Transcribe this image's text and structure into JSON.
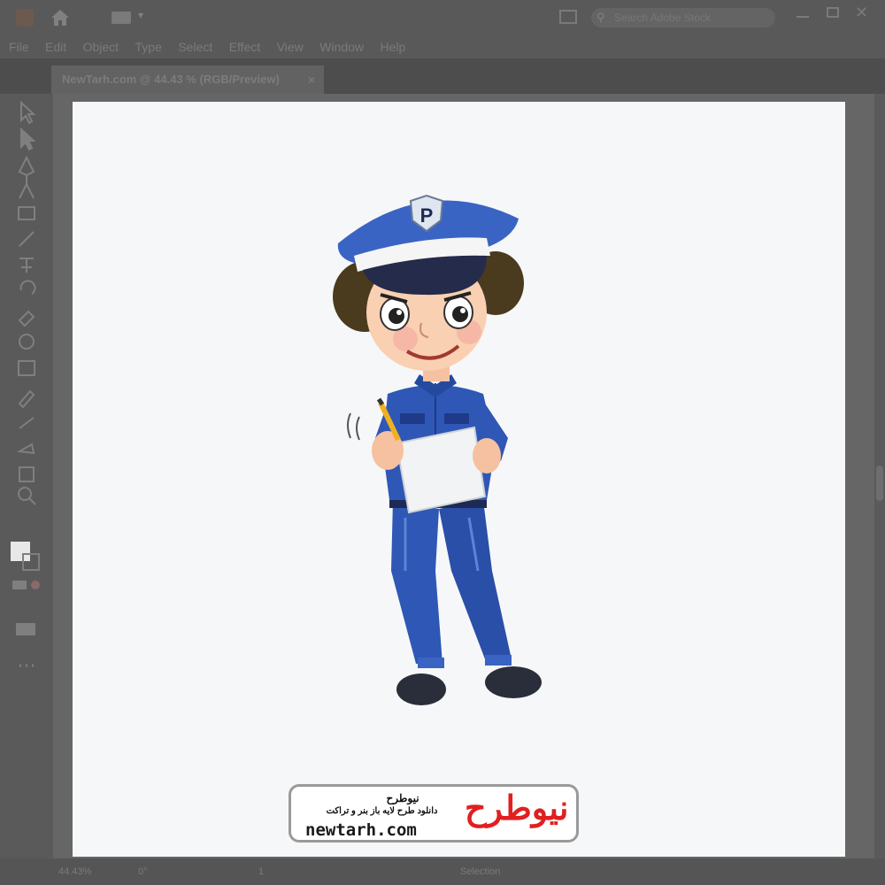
{
  "app": {
    "menu": [
      "File",
      "Edit",
      "Object",
      "Type",
      "Select",
      "Effect",
      "View",
      "Window",
      "Help"
    ],
    "search_placeholder": "Search Adobe Stock"
  },
  "document": {
    "tab_title": "NewTarh.com @ 44.43 % (RGB/Preview)",
    "close_symbol": "×"
  },
  "status": {
    "zoom": "44.43%",
    "rotation": "0°",
    "artboard_number": "1",
    "tool_name": "Selection"
  },
  "watermark": {
    "title_fa": "نیوطرح",
    "subtitle_fa": "دانلود طرح لایه باز بنر و تراکت",
    "mark_fa": "نیوطرح",
    "url": "newtarh.com"
  },
  "illustration": {
    "badge_letter": "P"
  },
  "colors": {
    "chrome": "#595959",
    "artboard": "#f6f7f8",
    "uniform_blue": "#2f57b5",
    "brand_red": "#e02020"
  },
  "icons": [
    "illustrator-logo-icon",
    "home-icon",
    "workspace-switcher-icon",
    "arrange-documents-icon",
    "search-icon",
    "minimize-icon",
    "maximize-icon",
    "close-icon",
    "selection-tool-icon",
    "direct-selection-tool-icon",
    "pen-tool-icon",
    "curvature-tool-icon",
    "rectangle-tool-icon",
    "paintbrush-tool-icon",
    "type-tool-icon",
    "rotate-tool-icon",
    "eraser-tool-icon",
    "shape-builder-icon",
    "gradient-tool-icon",
    "eyedropper-tool-icon",
    "blend-tool-icon",
    "symbol-sprayer-icon",
    "artboard-tool-icon",
    "zoom-tool-icon",
    "fill-stroke-icon",
    "drawing-mode-icon",
    "screen-mode-icon",
    "more-tools-icon"
  ]
}
